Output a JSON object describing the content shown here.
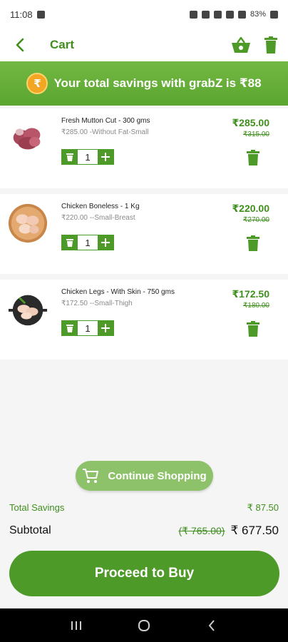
{
  "status_bar": {
    "time": "11:08",
    "battery": "83%"
  },
  "header": {
    "title": "Cart"
  },
  "savings_banner": {
    "coin_symbol": "₹",
    "text": "Your total savings with grabZ is ₹88"
  },
  "items": [
    {
      "name": "Fresh  Mutton Cut - 300 gms",
      "variant": "₹285.00 -Without Fat-Small",
      "price": "₹285.00",
      "mrp": "₹315.00",
      "qty": "1"
    },
    {
      "name": "Chicken Boneless  - 1 Kg",
      "variant": "₹220.00 --Small-Breast",
      "price": "₹220.00",
      "mrp": "₹270.00",
      "qty": "1"
    },
    {
      "name": "Chicken Legs - With Skin - 750 gms",
      "variant": "₹172.50 --Small-Thigh",
      "price": "₹172.50",
      "mrp": "₹180.00",
      "qty": "1"
    }
  ],
  "continue_shopping": {
    "label": "Continue Shopping"
  },
  "summary": {
    "total_savings_label": "Total Savings",
    "total_savings_value": "₹ 87.50",
    "subtotal_label": "Subtotal",
    "subtotal_mrp": "(₹ 765.00)",
    "subtotal_value": "₹ 677.50"
  },
  "proceed": {
    "label": "Proceed to Buy"
  },
  "colors": {
    "brand_green": "#4d9a28",
    "light_green": "#8dc26a",
    "coin": "#f2a623"
  }
}
